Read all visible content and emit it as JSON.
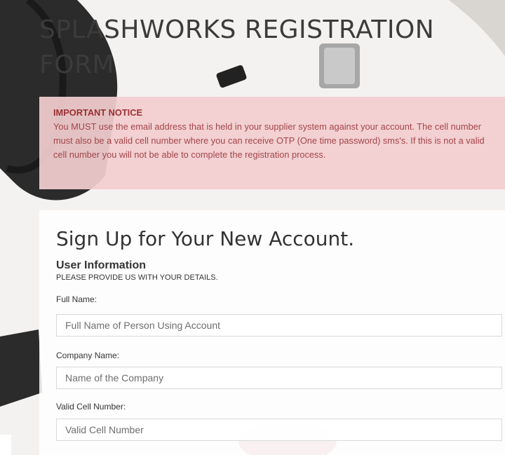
{
  "page": {
    "title": "SPLASHWORKS REGISTRATION FORM"
  },
  "notice": {
    "title": "IMPORTANT NOTICE",
    "body": "You MUST use the email address that is held in your supplier system against your account. The cell number must also be a valid cell number where you can receive OTP (One time password) sms's. If this is not a valid cell number you will not be able to complete the registration process."
  },
  "form": {
    "heading": "Sign Up for Your New Account.",
    "section_title": "User Information",
    "section_subtitle": "PLEASE PROVIDE US WITH YOUR DETAILS.",
    "fields": [
      {
        "label": "Full Name:",
        "placeholder": "Full Name of Person Using Account",
        "value": ""
      },
      {
        "label": "Company Name:",
        "placeholder": "Name of the Company",
        "value": ""
      },
      {
        "label": "Valid Cell Number:",
        "placeholder": "Valid Cell Number",
        "value": ""
      }
    ]
  },
  "colors": {
    "notice_bg": "#f2ced0",
    "notice_text": "#a3464a",
    "notice_title": "#9c2f33"
  },
  "icons": [
    "plumbing-hose-image",
    "pipe-fitting-image",
    "tap-image"
  ]
}
